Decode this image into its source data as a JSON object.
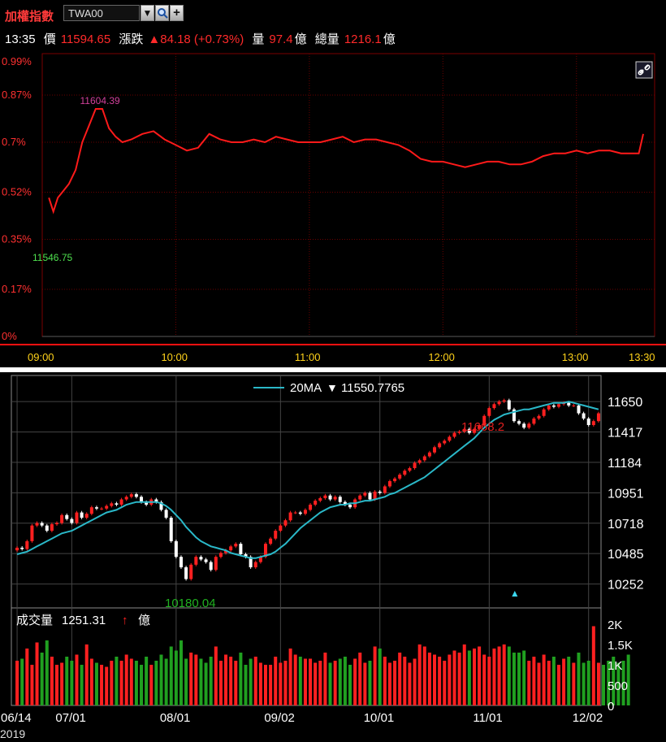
{
  "toolbar": {
    "title": "加權指數",
    "symbol": "TWA00",
    "dropdown_icon": "▼",
    "search_icon": "search",
    "add_icon": "+"
  },
  "quote": {
    "time": "13:35",
    "price_label": "價",
    "price": "11594.65",
    "change_label": "漲跌",
    "change": "▲84.18 (+0.73%)",
    "volume_label": "量",
    "volume": "97.4",
    "volume_unit": "億",
    "total_volume_label": "總量",
    "total_volume": "1216.1",
    "total_volume_unit": "億"
  },
  "colors": {
    "up": "#ff2020",
    "down": "#14a014",
    "ma": "#2ab8c8",
    "grid_red": "#7a0000"
  },
  "chart_data": [
    {
      "type": "line",
      "name": "intraday",
      "x_unit": "time",
      "xlim": [
        "09:00",
        "13:30"
      ],
      "x_ticks": [
        "09:00",
        "10:00",
        "11:00",
        "12:00",
        "13:00",
        "13:30"
      ],
      "y_unit": "percent",
      "ylim": [
        0,
        0.99
      ],
      "y_ticks": [
        "0%",
        "0.17%",
        "0.35%",
        "0.52%",
        "0.7%",
        "0.87%",
        "0.99%"
      ],
      "y_tick_values": [
        0,
        0.17,
        0.35,
        0.52,
        0.7,
        0.87,
        0.99
      ],
      "annotations": [
        {
          "text": "11604.39",
          "time": "09:25"
        },
        {
          "text": "11546.75",
          "time": "09:00"
        }
      ],
      "link_icon": "link",
      "points": [
        [
          "09:03",
          0.5
        ],
        [
          "09:05",
          0.45
        ],
        [
          "09:07",
          0.5
        ],
        [
          "09:09",
          0.52
        ],
        [
          "09:12",
          0.55
        ],
        [
          "09:15",
          0.6
        ],
        [
          "09:18",
          0.7
        ],
        [
          "09:21",
          0.76
        ],
        [
          "09:24",
          0.82
        ],
        [
          "09:27",
          0.82
        ],
        [
          "09:30",
          0.75
        ],
        [
          "09:33",
          0.72
        ],
        [
          "09:36",
          0.7
        ],
        [
          "09:40",
          0.71
        ],
        [
          "09:45",
          0.73
        ],
        [
          "09:50",
          0.74
        ],
        [
          "09:55",
          0.71
        ],
        [
          "10:00",
          0.69
        ],
        [
          "10:05",
          0.67
        ],
        [
          "10:10",
          0.68
        ],
        [
          "10:15",
          0.73
        ],
        [
          "10:20",
          0.71
        ],
        [
          "10:25",
          0.7
        ],
        [
          "10:30",
          0.7
        ],
        [
          "10:35",
          0.71
        ],
        [
          "10:40",
          0.7
        ],
        [
          "10:45",
          0.72
        ],
        [
          "10:50",
          0.71
        ],
        [
          "10:55",
          0.7
        ],
        [
          "11:00",
          0.7
        ],
        [
          "11:05",
          0.7
        ],
        [
          "11:10",
          0.71
        ],
        [
          "11:15",
          0.72
        ],
        [
          "11:20",
          0.7
        ],
        [
          "11:25",
          0.71
        ],
        [
          "11:30",
          0.71
        ],
        [
          "11:35",
          0.7
        ],
        [
          "11:40",
          0.69
        ],
        [
          "11:45",
          0.67
        ],
        [
          "11:50",
          0.64
        ],
        [
          "11:55",
          0.63
        ],
        [
          "12:00",
          0.63
        ],
        [
          "12:05",
          0.62
        ],
        [
          "12:10",
          0.61
        ],
        [
          "12:15",
          0.62
        ],
        [
          "12:20",
          0.63
        ],
        [
          "12:25",
          0.63
        ],
        [
          "12:30",
          0.62
        ],
        [
          "12:35",
          0.62
        ],
        [
          "12:40",
          0.63
        ],
        [
          "12:45",
          0.65
        ],
        [
          "12:50",
          0.66
        ],
        [
          "12:55",
          0.66
        ],
        [
          "13:00",
          0.67
        ],
        [
          "13:05",
          0.66
        ],
        [
          "13:10",
          0.67
        ],
        [
          "13:15",
          0.67
        ],
        [
          "13:20",
          0.66
        ],
        [
          "13:25",
          0.66
        ],
        [
          "13:28",
          0.66
        ],
        [
          "13:30",
          0.73
        ]
      ]
    },
    {
      "type": "candlestick",
      "name": "daily",
      "legend": {
        "name": "20MA",
        "arrow": "▼",
        "value": "11550.7765"
      },
      "ylim": [
        10100,
        11800
      ],
      "y_ticks": [
        "11650",
        "11417",
        "11184",
        "10951",
        "10718",
        "10485",
        "10252"
      ],
      "y_tick_values": [
        11650,
        11417,
        11184,
        10951,
        10718,
        10485,
        10252
      ],
      "x_ticks": [
        "06/14",
        "07/01",
        "08/01",
        "09/02",
        "10/01",
        "11/01",
        "12/02"
      ],
      "x_tick_index": [
        0,
        11,
        32,
        53,
        73,
        95,
        115
      ],
      "x_year": "2019",
      "high_label": "11668.2",
      "low_label": "10180.04",
      "marker": "▲",
      "marker_index": 100,
      "closes": [
        10530,
        10520,
        10580,
        10700,
        10720,
        10700,
        10660,
        10710,
        10720,
        10780,
        10750,
        10720,
        10800,
        10760,
        10790,
        10840,
        10830,
        10830,
        10850,
        10870,
        10860,
        10900,
        10920,
        10940,
        10920,
        10880,
        10860,
        10900,
        10880,
        10820,
        10760,
        10580,
        10460,
        10380,
        10290,
        10400,
        10460,
        10440,
        10420,
        10360,
        10460,
        10490,
        10510,
        10540,
        10560,
        10480,
        10460,
        10380,
        10420,
        10460,
        10560,
        10600,
        10660,
        10700,
        10740,
        10800,
        10800,
        10790,
        10820,
        10860,
        10890,
        10910,
        10930,
        10900,
        10920,
        10880,
        10860,
        10840,
        10900,
        10930,
        10950,
        10900,
        10960,
        10950,
        11000,
        11040,
        11060,
        11090,
        11120,
        11140,
        11180,
        11200,
        11230,
        11260,
        11300,
        11330,
        11350,
        11380,
        11410,
        11420,
        11440,
        11410,
        11440,
        11470,
        11540,
        11600,
        11630,
        11650,
        11660,
        11590,
        11500,
        11480,
        11450,
        11480,
        11520,
        11540,
        11590,
        11620,
        11610,
        11630,
        11640,
        11620,
        11620,
        11560,
        11520,
        11470,
        11500,
        11560
      ],
      "ma20": [
        10480,
        10490,
        10500,
        10520,
        10540,
        10560,
        10580,
        10600,
        10620,
        10640,
        10650,
        10660,
        10680,
        10700,
        10720,
        10740,
        10760,
        10780,
        10800,
        10810,
        10820,
        10840,
        10860,
        10870,
        10880,
        10880,
        10880,
        10880,
        10880,
        10870,
        10850,
        10820,
        10780,
        10740,
        10690,
        10650,
        10610,
        10580,
        10560,
        10540,
        10530,
        10520,
        10510,
        10490,
        10480,
        10470,
        10460,
        10450,
        10450,
        10460,
        10470,
        10480,
        10500,
        10530,
        10560,
        10600,
        10640,
        10680,
        10710,
        10740,
        10770,
        10800,
        10820,
        10840,
        10850,
        10860,
        10860,
        10870,
        10870,
        10880,
        10890,
        10890,
        10900,
        10910,
        10920,
        10940,
        10950,
        10970,
        10990,
        11010,
        11030,
        11050,
        11070,
        11100,
        11130,
        11160,
        11190,
        11220,
        11250,
        11280,
        11310,
        11340,
        11370,
        11410,
        11450,
        11480,
        11510,
        11530,
        11550,
        11560,
        11570,
        11580,
        11590,
        11590,
        11600,
        11610,
        11620,
        11630,
        11640,
        11640,
        11640,
        11650,
        11640,
        11630,
        11620,
        11610,
        11600,
        11590
      ]
    },
    {
      "type": "bar",
      "name": "volume",
      "label": "成交量",
      "value": "1251.31",
      "arrow": "↑",
      "unit": "億",
      "ylim": [
        0,
        2200
      ],
      "y_ticks": [
        "2K",
        "1.5K",
        "1K",
        "500",
        "0"
      ],
      "y_tick_values": [
        2000,
        1500,
        1000,
        500,
        0
      ],
      "values": [
        1100,
        1150,
        1400,
        1000,
        1550,
        1300,
        1600,
        1200,
        1000,
        1050,
        1200,
        1100,
        1250,
        1000,
        1500,
        1150,
        1050,
        1000,
        950,
        1100,
        1200,
        1100,
        1250,
        1150,
        1100,
        1000,
        1200,
        1000,
        1100,
        1250,
        1150,
        1450,
        1350,
        1600,
        1150,
        1300,
        1250,
        1150,
        1050,
        1200,
        1450,
        1100,
        1250,
        1200,
        1100,
        1300,
        1000,
        1150,
        1200,
        1050,
        1000,
        1000,
        1200,
        1050,
        1100,
        1400,
        1250,
        1200,
        1150,
        1150,
        1050,
        1100,
        1300,
        1050,
        1100,
        1150,
        1200,
        1000,
        1150,
        1300,
        1050,
        1100,
        1450,
        1400,
        1200,
        1050,
        1100,
        1300,
        1200,
        1050,
        1150,
        1500,
        1450,
        1300,
        1250,
        1200,
        1100,
        1250,
        1350,
        1300,
        1500,
        1350,
        1400,
        1450,
        1250,
        1200,
        1400,
        1450,
        1500,
        1450,
        1300,
        1300,
        1350,
        1100,
        1200,
        1050,
        1250,
        1100,
        1200,
        1000,
        1150,
        1200,
        1050,
        1300,
        1050,
        1100,
        1950,
        1050,
        1000,
        1100,
        1200,
        1050,
        1100,
        1250
      ]
    }
  ]
}
